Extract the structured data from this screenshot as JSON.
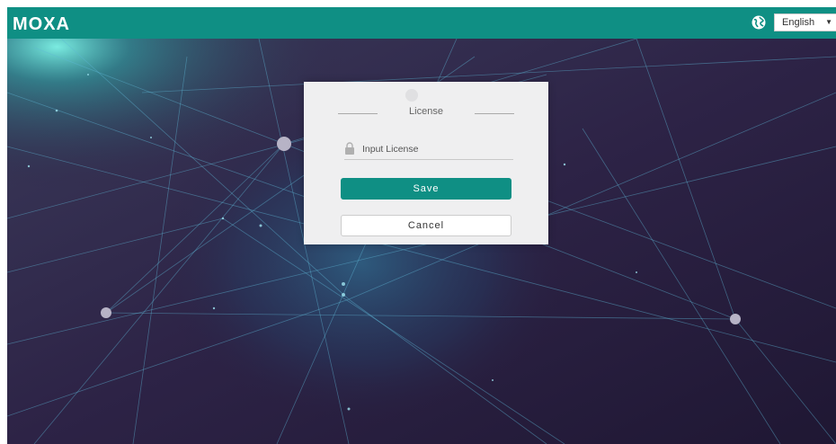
{
  "header": {
    "logo_text": "MOXA",
    "language": {
      "selected": "English"
    },
    "accent_color": "#0f8f84"
  },
  "dialog": {
    "title": "License",
    "license_field": {
      "placeholder": "Input License",
      "value": ""
    },
    "save_label": "Save",
    "cancel_label": "Cancel"
  },
  "icons": {
    "language": "globe-icon",
    "field": "lock-icon",
    "caret": "caret-down-icon"
  }
}
